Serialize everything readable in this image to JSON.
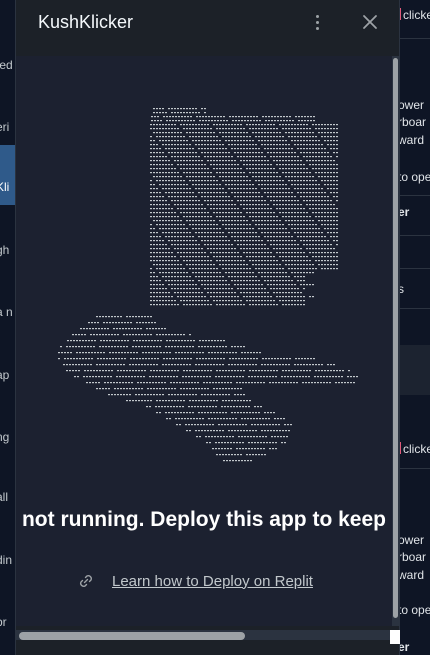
{
  "dialog": {
    "title": "KushKlicker",
    "menu_icon": "more-vertical-icon",
    "close_icon": "close-icon"
  },
  "message": {
    "headline": "not running. Deploy this app to keep",
    "link_icon": "link-icon",
    "link_text": "Learn how to Deploy on Replit"
  },
  "background_left": {
    "fragments": [
      "ted",
      "eri",
      "Kli",
      "gh",
      "a n",
      "ap",
      "ng",
      "all",
      "din",
      "br"
    ]
  },
  "background_right": {
    "fragments": [
      "clicke",
      "ower",
      "rboar",
      "ward",
      "to ope",
      "er",
      "s",
      "clicke",
      "ower",
      "rboar",
      "ward",
      "to ope",
      "er"
    ]
  },
  "colors": {
    "page_bg": "#1c2128",
    "content_bg": "#1c2130",
    "ascii_art": "#c2c8cc",
    "accent_active": "#2f5a8a"
  }
}
